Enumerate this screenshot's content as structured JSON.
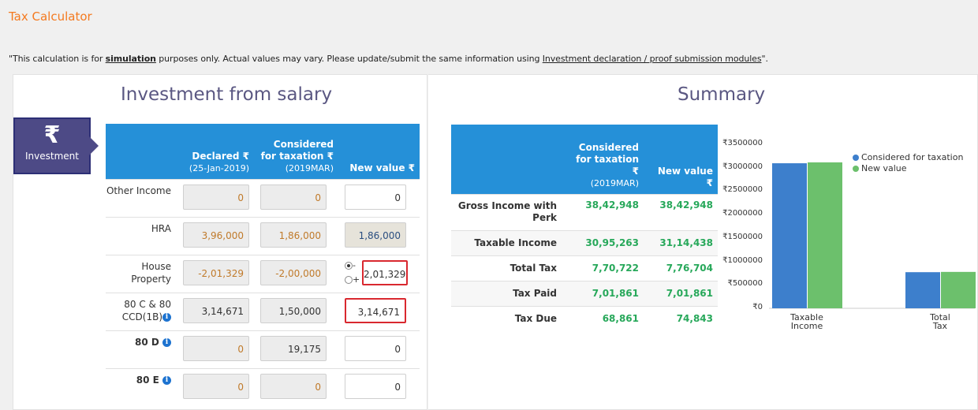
{
  "page": {
    "title": "Tax Calculator",
    "notice_pre": "\"This calculation is for ",
    "notice_link1": "simulation",
    "notice_mid": " purposes only. Actual values may vary. Please update/submit the same information using ",
    "notice_link2": "Investment declaration / proof submission modules",
    "notice_post": "\"."
  },
  "investment": {
    "heading": "Investment from salary",
    "tag_icon": "₹",
    "tag_label": "Investment",
    "columns": {
      "declared": "Declared ₹",
      "declared_sub": "(25-Jan-2019)",
      "considered": "Considered for taxation ₹",
      "considered_sub": "(2019MAR)",
      "new_value": "New value ₹"
    },
    "rows": [
      {
        "label": "Other Income",
        "declared": "0",
        "considered": "0",
        "new_value": "0"
      },
      {
        "label": "HRA",
        "declared": "3,96,000",
        "considered": "1,86,000",
        "new_value": "1,86,000"
      },
      {
        "label": "House Property",
        "declared": "-2,01,329",
        "considered": "-2,00,000",
        "new_value": "2,01,329",
        "radio_minus": "-",
        "radio_plus": "+"
      },
      {
        "label": "80 C & 80 CCD(1B)",
        "declared": "3,14,671",
        "considered": "1,50,000",
        "new_value": "3,14,671"
      },
      {
        "label": "80 D",
        "declared": "0",
        "considered": "19,175",
        "new_value": "0"
      },
      {
        "label": "80 E",
        "declared": "0",
        "considered": "0",
        "new_value": "0"
      }
    ],
    "info_icon": "i"
  },
  "summary": {
    "heading": "Summary",
    "columns": {
      "considered": "Considered for taxation ₹",
      "considered_sub": "(2019MAR)",
      "new_value": "New value ₹"
    },
    "rows": [
      {
        "label": "Gross Income with Perk",
        "considered": "38,42,948",
        "new_value": "38,42,948"
      },
      {
        "label": "Taxable Income",
        "considered": "30,95,263",
        "new_value": "31,14,438"
      },
      {
        "label": "Total Tax",
        "considered": "7,70,722",
        "new_value": "7,76,704"
      },
      {
        "label": "Tax Paid",
        "considered": "7,01,861",
        "new_value": "7,01,861"
      },
      {
        "label": "Tax Due",
        "considered": "68,861",
        "new_value": "74,843"
      }
    ]
  },
  "chart_data": {
    "type": "bar",
    "categories": [
      "Taxable Income",
      "Total Tax"
    ],
    "series": [
      {
        "name": "Considered for taxation",
        "color": "#3d7fcc",
        "values": [
          3095263,
          770722
        ]
      },
      {
        "name": "New value",
        "color": "#6cc06c",
        "values": [
          3114438,
          776704
        ]
      }
    ],
    "y_ticks": [
      "₹0",
      "₹500000",
      "₹1000000",
      "₹1500000",
      "₹2000000",
      "₹2500000",
      "₹3000000",
      "₹3500000"
    ],
    "ylim": [
      0,
      3500000
    ],
    "legend": "top-right"
  }
}
